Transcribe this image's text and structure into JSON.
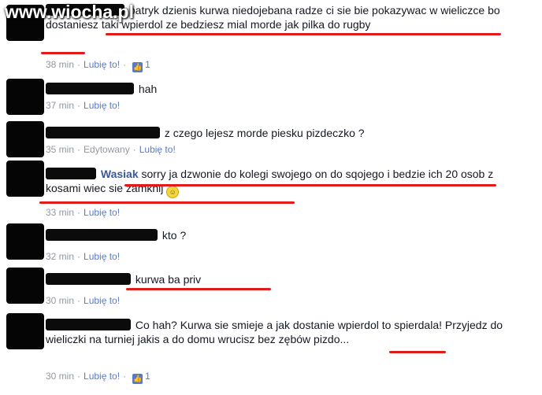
{
  "watermark": "www.wiocha.pl",
  "comments": [
    {
      "text": "patryk dzienis kurwa niedojebana radze ci sie bie pokazywac w wieliczce bo dostaniesz taki wpierdol ze bedziesz mial morde jak pilka do rugby",
      "time": "38 min",
      "like": "Lubię to!",
      "likes": "1"
    },
    {
      "text": "hah",
      "time": "37 min",
      "like": "Lubię to!"
    },
    {
      "text": "z czego lejesz morde piesku pizdeczko ?",
      "time": "35 min",
      "edited": "Edytowany",
      "like": "Lubię to!"
    },
    {
      "author": "Wasiak",
      "text": "sorry ja dzwonie do kolegi swojego on do sqojego i bedzie ich 20 osob z kosami wiec sie zamknij",
      "time": "33 min",
      "like": "Lubię to!"
    },
    {
      "text": "kto ?",
      "time": "32 min",
      "like": "Lubię to!"
    },
    {
      "text": "kurwa ba priv",
      "time": "30 min",
      "like": "Lubię to!"
    },
    {
      "text": "Co hah? Kurwa sie smieje a jak dostanie wpierdol to spierdala! Przyjedz do wieliczki na turniej jakis a do domu wrucisz bez zębów pizdo...",
      "time": "30 min",
      "like": "Lubię to!",
      "likes": "1"
    }
  ],
  "colors": {
    "underline": "#e31a1a",
    "link": "#5b7bc0",
    "meta": "#9197a3"
  }
}
